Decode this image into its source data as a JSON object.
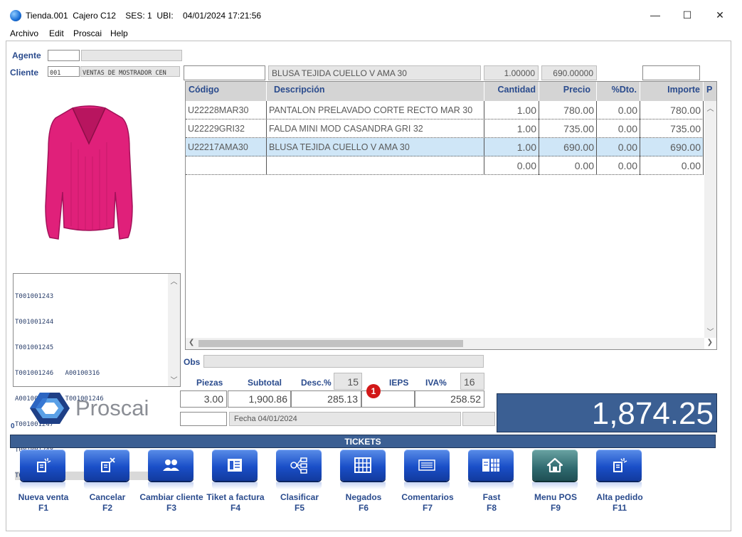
{
  "window": {
    "title": "Tienda.001  Cajero C12    SES: 1  UBI:    04/01/2024 17:21:56",
    "minimize": "—",
    "maximize": "☐",
    "close": "✕"
  },
  "menu": [
    "Archivo",
    "Edit",
    "Proscai",
    "Help"
  ],
  "agente": {
    "label": "Agente",
    "code": "",
    "name": ""
  },
  "cliente": {
    "label": "Cliente",
    "code": "001",
    "name": "VENTAS DE MOSTRADOR CEN"
  },
  "entry": {
    "codigo": "",
    "descripcion": "BLUSA TEJIDA CUELLO V AMA 30",
    "cantidad": "1.00000",
    "precio": "690.00000",
    "extra": ""
  },
  "grid": {
    "headers": [
      "Código",
      "Descripción",
      "Cantidad",
      "Precio",
      "%Dto.",
      "Importe",
      "P"
    ],
    "rows": [
      {
        "codigo": "U22228MAR30",
        "descripcion": "PANTALON PRELAVADO CORTE RECTO MAR 30",
        "cantidad": "1.00",
        "precio": "780.00",
        "dto": "0.00",
        "importe": "780.00"
      },
      {
        "codigo": "U22229GRI32",
        "descripcion": "FALDA MINI MOD CASANDRA GRI 32",
        "cantidad": "1.00",
        "precio": "735.00",
        "dto": "0.00",
        "importe": "735.00"
      },
      {
        "codigo": "U22217AMA30",
        "descripcion": "BLUSA TEJIDA CUELLO V AMA 30",
        "cantidad": "1.00",
        "precio": "690.00",
        "dto": "0.00",
        "importe": "690.00"
      },
      {
        "codigo": "",
        "descripcion": "",
        "cantidad": "0.00",
        "precio": "0.00",
        "dto": "0.00",
        "importe": "0.00"
      }
    ],
    "selected_row": 2
  },
  "tickets_list": [
    "T001001243",
    "T001001244",
    "T001001245",
    "T001001246   A00100316",
    "A00100316    T001001246",
    "T001001247",
    "T001001248",
    "T001001249"
  ],
  "obs": {
    "label": "Obs",
    "value": ""
  },
  "totals": {
    "piezas_label": "Piezas",
    "piezas": "3.00",
    "subtotal_label": "Subtotal",
    "subtotal": "1,900.86",
    "desc_label": "Desc.%",
    "desc_pct": "15",
    "desc": "285.13",
    "ieps_label": "IEPS",
    "ieps": "",
    "iva_label": "IVA%",
    "iva_pct": "16",
    "iva": "258.52",
    "badge": "1",
    "grand_total": "1,874.25"
  },
  "fecha": "Fecha 04/01/2024",
  "counter": "0",
  "logo_text": "Proscai",
  "tickets_title": "TICKETS",
  "fkeys": [
    {
      "label": "Nueva venta",
      "key": "F1",
      "icon": "new-sale-icon"
    },
    {
      "label": "Cancelar",
      "key": "F2",
      "icon": "cancel-icon"
    },
    {
      "label": "Cambiar cliente",
      "key": "F3",
      "icon": "users-icon"
    },
    {
      "label": "Tiket a factura",
      "key": "F4",
      "icon": "invoice-icon"
    },
    {
      "label": "Clasificar",
      "key": "F5",
      "icon": "classify-icon"
    },
    {
      "label": "Negados",
      "key": "F6",
      "icon": "grid-icon"
    },
    {
      "label": "Comentarios",
      "key": "F7",
      "icon": "comments-icon"
    },
    {
      "label": "Fast",
      "key": "F8",
      "icon": "fast-icon"
    },
    {
      "label": "Menu POS",
      "key": "F9",
      "icon": "home-icon"
    },
    {
      "label": "Alta pedido",
      "key": "F11",
      "icon": "new-order-icon"
    }
  ],
  "colors": {
    "accent": "#3b5f93",
    "label_blue": "#2a4b8d",
    "selected_row": "#cfe6f7",
    "product_pink": "#e0207a"
  }
}
